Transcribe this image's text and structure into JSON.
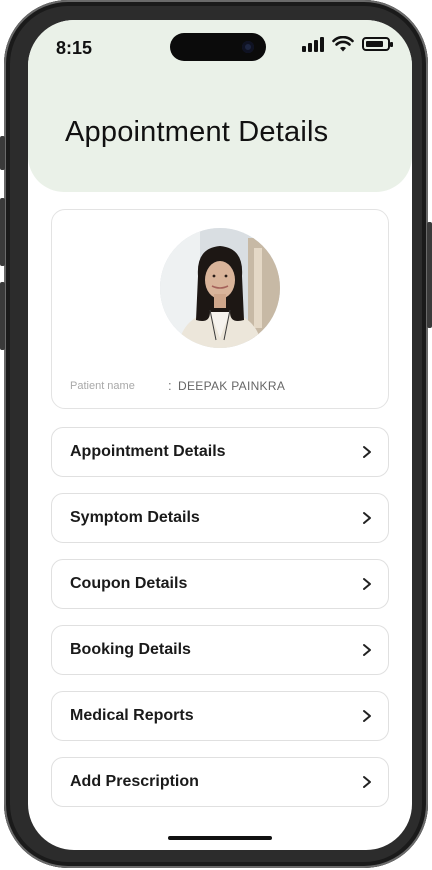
{
  "status_bar": {
    "time": "8:15",
    "icons": [
      "cellular-signal-icon",
      "wifi-icon",
      "battery-icon"
    ],
    "battery_level": 0.85
  },
  "header": {
    "title": "Appointment Details",
    "background": "#eaf1e8"
  },
  "patient": {
    "label": "Patient name",
    "separator": ":",
    "name": "DEEPAK PAINKRA",
    "avatar_icon": "patient-photo"
  },
  "menu": [
    {
      "label": "Appointment Details",
      "icon": "chevron-right-icon"
    },
    {
      "label": "Symptom Details",
      "icon": "chevron-right-icon"
    },
    {
      "label": "Coupon Details",
      "icon": "chevron-right-icon"
    },
    {
      "label": "Booking Details",
      "icon": "chevron-right-icon"
    },
    {
      "label": "Medical Reports",
      "icon": "chevron-right-icon"
    },
    {
      "label": "Add Prescription",
      "icon": "chevron-right-icon"
    }
  ]
}
